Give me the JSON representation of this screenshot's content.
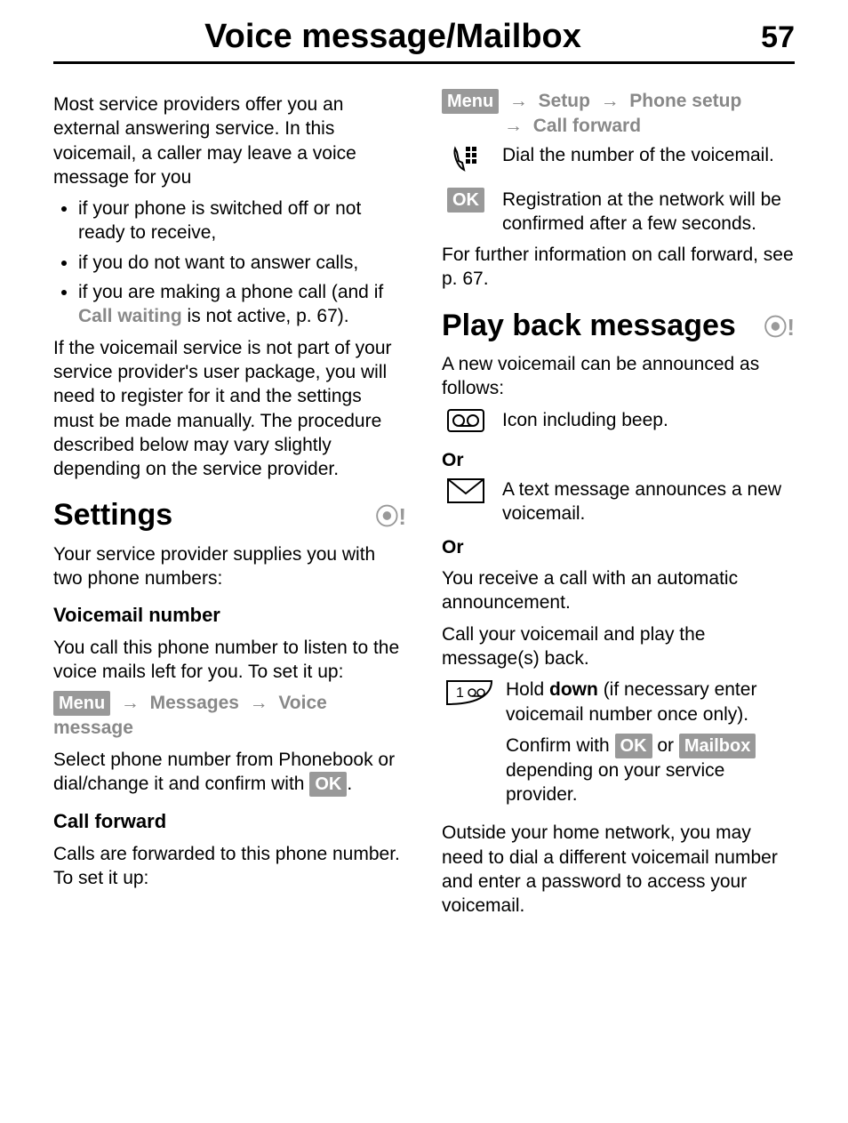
{
  "header": {
    "title": "Voice message/Mailbox",
    "page_number": "57"
  },
  "left": {
    "intro": "Most service providers offer you an external answering service. In this voicemail, a caller may leave a voice message for you",
    "bullets": [
      "if your phone is switched off or not ready to receive,",
      "if you do not want to answer calls,",
      "if you are making a phone call (and if "
    ],
    "bullet3_emph": "Call waiting",
    "bullet3_tail": " is not active, p. 67).",
    "registration_para": "If the voicemail service is not part of your service provider's user package, you will need to register for it and the settings must be made manually. The procedure described below may vary slightly depending on the service provider.",
    "settings_heading": "Settings",
    "settings_intro": "Your service provider supplies you with two phone numbers:",
    "voicemail_sub": "Voicemail number",
    "voicemail_para": "You call this phone number to listen to the voice mails left for you. To set it up:",
    "menu_key": "Menu",
    "nav_messages": "Messages",
    "nav_voice_message": "Voice message",
    "voicemail_setup_para_1": "Select phone number from Phonebook or dial/change it and confirm with ",
    "ok_key": "OK",
    "voicemail_setup_para_2": ".",
    "callforward_sub": "Call forward",
    "callforward_para": "Calls are forwarded to this phone number. To set it up:"
  },
  "right": {
    "menu_key": "Menu",
    "nav_setup": "Setup",
    "nav_phone_setup": "Phone setup",
    "nav_call_forward": "Call forward",
    "dial_text": "Dial the number of the voicemail.",
    "ok_key": "OK",
    "reg_text": "Registration at the network will be confirmed after a few seconds.",
    "further_info": "For further information on call forward, see p. 67.",
    "playback_heading": "Play back messages",
    "playback_intro": "A new voicemail can be announced as follows:",
    "icon_beep_text": "Icon including beep.",
    "or_label": "Or",
    "msg_text": "A text message announces a new voicemail.",
    "auto_announce": "You receive a call with an automatic announcement.",
    "call_vm": "Call your voicemail and play the message(s) back.",
    "hold_down_pre": "Hold ",
    "hold_down_bold": "down",
    "hold_down_tail": " (if necessary enter voicemail number once only).",
    "confirm_pre": "Confirm with ",
    "confirm_or": " or ",
    "mailbox_key": "Mailbox",
    "confirm_tail": " depending on your service provider.",
    "outside_para": "Outside your home network, you may need to dial a different voicemail number and enter a password to access your voicemail."
  }
}
